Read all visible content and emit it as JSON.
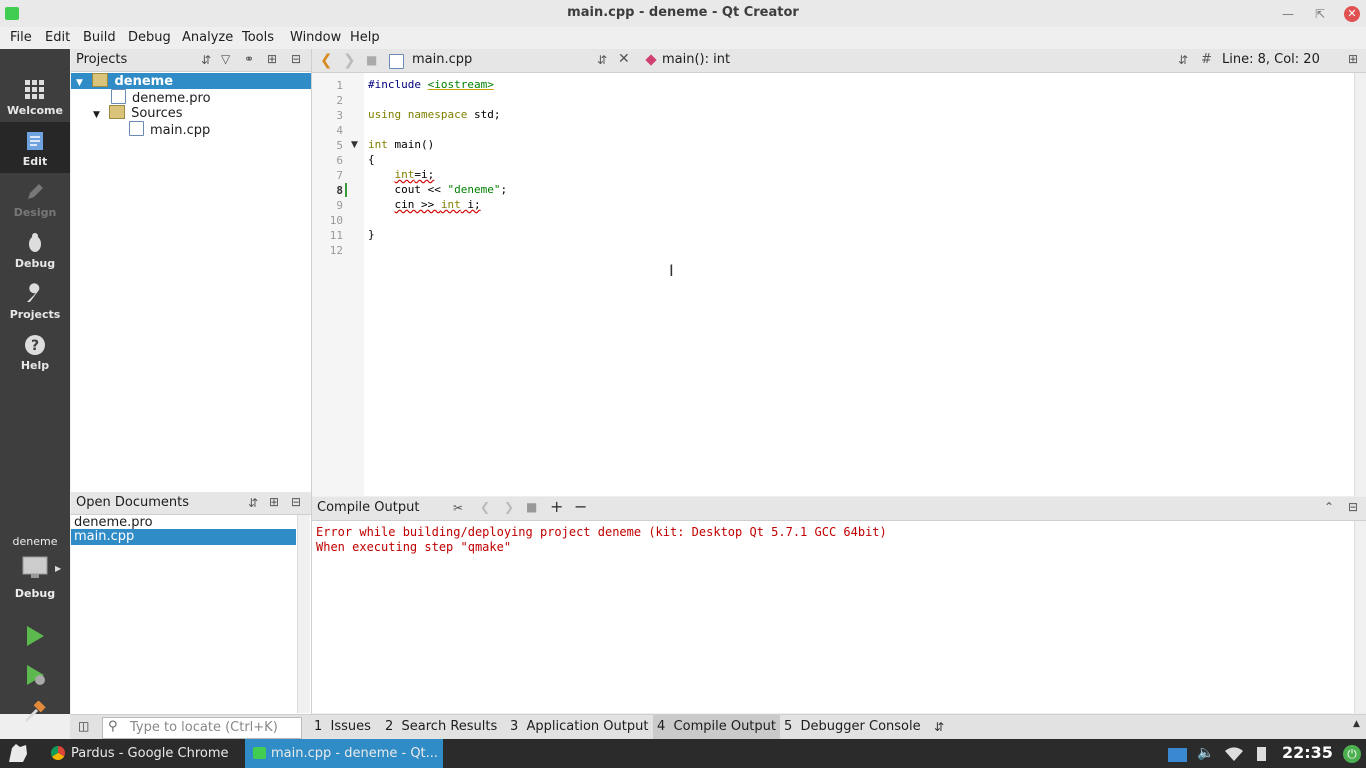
{
  "window": {
    "title": "main.cpp - deneme - Qt Creator"
  },
  "menu": [
    "File",
    "Edit",
    "Build",
    "Debug",
    "Analyze",
    "Tools",
    "Window",
    "Help"
  ],
  "modes": [
    {
      "label": "Welcome",
      "icon": "grid-icon"
    },
    {
      "label": "Edit",
      "icon": "document-icon"
    },
    {
      "label": "Design",
      "icon": "pencil-icon"
    },
    {
      "label": "Debug",
      "icon": "bug-icon"
    },
    {
      "label": "Projects",
      "icon": "wrench-icon"
    },
    {
      "label": "Help",
      "icon": "help-icon"
    }
  ],
  "kit": {
    "project": "deneme",
    "config": "Debug"
  },
  "projects": {
    "title": "Projects",
    "tree": {
      "root": "deneme",
      "pro": "deneme.pro",
      "sources": "Sources",
      "main": "main.cpp"
    }
  },
  "open_documents": {
    "title": "Open Documents",
    "items": [
      "deneme.pro",
      "main.cpp"
    ]
  },
  "editor": {
    "file": "main.cpp",
    "symbol": "main(): int",
    "hash": "#",
    "position": "Line: 8, Col: 20",
    "lines": [
      {
        "n": "1"
      },
      {
        "n": "2"
      },
      {
        "n": "3"
      },
      {
        "n": "4"
      },
      {
        "n": "5"
      },
      {
        "n": "6"
      },
      {
        "n": "7"
      },
      {
        "n": "8"
      },
      {
        "n": "9"
      },
      {
        "n": "10"
      },
      {
        "n": "11"
      },
      {
        "n": "12"
      }
    ]
  },
  "output": {
    "title": "Compile Output",
    "lines": [
      "Error while building/deploying project deneme (kit: Desktop Qt 5.7.1 GCC 64bit)",
      "When executing step \"qmake\""
    ]
  },
  "statusbar": {
    "locate_placeholder": "Type to locate (Ctrl+K)",
    "tabs": [
      "1  Issues",
      "2  Search Results",
      "3  Application Output",
      "4  Compile Output",
      "5  Debugger Console"
    ]
  },
  "taskbar": {
    "tasks": [
      "Pardus - Google Chrome",
      "main.cpp - deneme - Qt..."
    ],
    "clock": "22:35"
  },
  "colors": {
    "accent": "#308cc6",
    "modebar": "#3e3e3e",
    "error": "#c00000",
    "taskbar": "#2b2b2b"
  }
}
